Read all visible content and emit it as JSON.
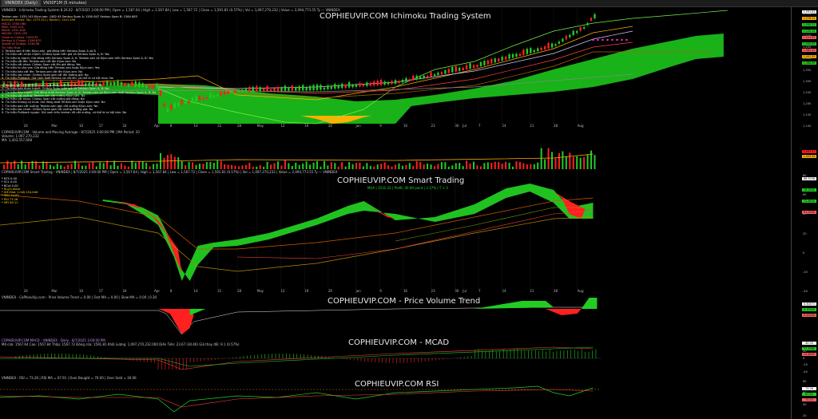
{
  "tabs": [
    {
      "label": "VNINDEX (Daily)",
      "active": true
    },
    {
      "label": "VN30F1M (5 minutes)",
      "active": false
    }
  ],
  "colors": {
    "up": "#22cc22",
    "down": "#ff2020",
    "kumo": "#19b219",
    "lime": "#76f04a",
    "gold": "#ffb000",
    "magenta": "#ff33cc",
    "orange": "#cc7a00"
  },
  "panel1": {
    "header": "VNINDEX - Ichimoku Trading System 8.26.02 - 8/7/2025 3:00:00 PM | Open = 1,567.64 | High = 1,567.84 | Low = 1,567.72 | Close = 1,591.81 (0.57%) | Vol = 1,097,270,232 | Value = 2,094,773.55 Ty — VNINDEX",
    "title": "COPHIEUVIP.COM Ichimoku Trading System",
    "legend": [
      {
        "text": "Tenkan-sen: 1535.145   Kijun-sen: 1482.45   Senkou Span A: 1500.847   Senkou Span B: 1364.685",
        "color": "#e8e8e8"
      },
      {
        "text": "Bollinger Bands: Top: 1579.312 | Bottom: 1441.498",
        "color": "#ffb000"
      },
      {
        "text": "MACD: 1500.064",
        "color": "#ff6060"
      },
      {
        "text": "MA5: 1545.214",
        "color": "#ff6060"
      },
      {
        "text": "MA20: 1531.618",
        "color": "#ff6060"
      },
      {
        "text": "MA200: 1305.139",
        "color": "#ff6060"
      },
      {
        "text": "Close vs Chikou: 1583.99",
        "color": "#ff6060"
      },
      {
        "text": "Senkou A Chikou: 1298.870",
        "color": "#ff6060"
      },
      {
        "text": "SpanB vs Chikou: 1236.98",
        "color": "#ff6060"
      },
      {
        "text": "Tin hiệu Mua:",
        "color": "#ff6060"
      },
      {
        "text": "1. Tenkan-sen ở trên Kijun-sen, giá đóng trên Senkou Span A và B",
        "color": "#e8e8e8"
      },
      {
        "text": "2. Tín hiệu cắt: nhận mạnh: Chikou Span trên giá và Senkou Span A, B: Yes",
        "color": "#e8e8e8"
      },
      {
        "text": "3. Tín hiệu bị mạnh: Giá đóng trên Senkou Span A, B. Tenkan-sen và Kijun-sen trên Senkou Span A, B: Yes",
        "color": "#e8e8e8"
      },
      {
        "text": "4. Tín hiệu cắt lên: Tenkan-sen cắt lên Kijun-sen: No",
        "color": "#e8e8e8"
      },
      {
        "text": "5. Tín hiệu cắt nhan: Chikou Span cắt lên giá đóng: Yes",
        "color": "#e8e8e8"
      },
      {
        "text": "6. Tín hiệu to cho yes: Giá đóng trên Tenkan-sen hoặc Kijun-sen: Yes",
        "color": "#e8e8e8"
      },
      {
        "text": "7. Tín hiệu bán cắt lên: Tenkan-sen cắt lên Kijun-sen: No",
        "color": "#e8e8e8"
      },
      {
        "text": "8. Tín hiệu sac nhan: Chikou Span gạn cắt lên đường giá: No",
        "color": "#e8e8e8"
      },
      {
        "text": "9. Tín hiệu Pullback: Giá nam dưới tenkan và cắt lên, có thể là cơ hội mua: No",
        "color": "#e8e8e8"
      },
      {
        "text": "Tín hiệu Bán:",
        "color": "#ff6060"
      },
      {
        "text": "1. Tenkan-sen ở dưới Kijun-sen, giá đóng dưới Senkou Span A và B: No",
        "color": "#e8e8e8"
      },
      {
        "text": "2. Tín hiệu bán nhan mạnh: Chikou Span dưới giá và Senkou Span A, B: No",
        "color": "#e8e8e8"
      },
      {
        "text": "3. Tín hiệu Bán mạnh: Giá đóng dưới Senkou Span A, B. Tenkan-sen và Kijun-sen dưới Senkou Span A, B: No",
        "color": "#e8e8e8"
      },
      {
        "text": "4. Tín hiệu cắt xuống: Tenkan-sen cắt xuống Kijun-sen: No",
        "color": "#e8e8e8"
      },
      {
        "text": "5. Tín hiệu cắt nhan: Chikou Span cắt xuống giá đóng: No",
        "color": "#e8e8e8"
      },
      {
        "text": "6. Tín hiệu Khang cự mua: Giá đóng dưới Tenkan-sen hoặc Kijun-sen: No",
        "color": "#e8e8e8"
      },
      {
        "text": "7. Tín hiệu gạn cắt xuống: Tenkan-sen gạn cắt xuống Kijun-sen: No",
        "color": "#e8e8e8"
      },
      {
        "text": "8. Tín hiệu sac nhan: Chikou Span gạn cắt xuống đường giá: No",
        "color": "#e8e8e8"
      },
      {
        "text": "9. Tín hiệu Pullback ngược: Giá nam trên tenkan rồi cắt xuống, có thể là cơ hội bán: No",
        "color": "#e8e8e8"
      }
    ],
    "price_tags": [
      {
        "text": "1,591.81",
        "bg": "#ffffff"
      },
      {
        "text": "1,578.31",
        "bg": "#ffb000"
      },
      {
        "text": "1,545.21",
        "bg": "#22cc22"
      },
      {
        "text": "1,535.15",
        "bg": "#22cc22"
      },
      {
        "text": "1,531.62",
        "bg": "#ff6060"
      },
      {
        "text": "1,500.85",
        "bg": "#22cc22"
      },
      {
        "text": "1,482.45",
        "bg": "#ff6060"
      },
      {
        "text": "1,441.50",
        "bg": "#ffb000"
      },
      {
        "text": "1,364.69",
        "bg": "#22cc22"
      }
    ],
    "axis_labels": [
      "1,600",
      "1,550",
      "1,500",
      "1,450",
      "1,400",
      "1,350",
      "1,300",
      "1,250",
      "1,200",
      "1,150",
      "1,100"
    ]
  },
  "xaxis": {
    "labels": [
      {
        "text": "24",
        "pos": 0.03
      },
      {
        "text": "Mar",
        "pos": 0.065
      },
      {
        "text": "10",
        "pos": 0.1
      },
      {
        "text": "17",
        "pos": 0.125
      },
      {
        "text": "24",
        "pos": 0.155
      },
      {
        "text": "Apr",
        "pos": 0.195
      },
      {
        "text": "8",
        "pos": 0.215
      },
      {
        "text": "14",
        "pos": 0.245
      },
      {
        "text": "21",
        "pos": 0.275
      },
      {
        "text": "28",
        "pos": 0.3
      },
      {
        "text": "May",
        "pos": 0.325
      },
      {
        "text": "12",
        "pos": 0.355
      },
      {
        "text": "19",
        "pos": 0.385
      },
      {
        "text": "26",
        "pos": 0.415
      },
      {
        "text": "Jun",
        "pos": 0.45
      },
      {
        "text": "9",
        "pos": 0.48
      },
      {
        "text": "16",
        "pos": 0.51
      },
      {
        "text": "23",
        "pos": 0.545
      },
      {
        "text": "30",
        "pos": 0.575
      },
      {
        "text": "Jul",
        "pos": 0.585
      },
      {
        "text": "7",
        "pos": 0.605
      },
      {
        "text": "14",
        "pos": 0.635
      },
      {
        "text": "21",
        "pos": 0.67
      },
      {
        "text": "28",
        "pos": 0.7
      },
      {
        "text": "Aug",
        "pos": 0.73
      }
    ]
  },
  "panel2": {
    "header": "COPHIEUVIP.COM - Volume and Moving Average - 8/7/2025 3:00:00 PM | MA Period: 20",
    "line2": "Volume: 1,097,270,232",
    "line3": "MA: 1,403,557,608",
    "tags": [
      {
        "text": "1,097.27",
        "bg": "#ff2020"
      },
      {
        "text": "1,403.56",
        "bg": "#ffb000"
      }
    ]
  },
  "panel3": {
    "header": "COPHIEUVIP.COM Smart Trading - VNINDEX | 8/7/2025 3:00:00 PM | Open = 1,567.64 | High = 1,567.84 | Low = 1,567.72 | Close = 1,591.81 (0.57%) | Vol = 1,097,270,232 | Value = 2,094,773.55 Ty — VNINDEX",
    "title": "COPHIEUVIP.COM Smart Trading",
    "subinfo": "MUA | 1531.22 | Profit: 40.69 point | 3.17% | T + 3",
    "legend": [
      {
        "text": "* BTS    0.00",
        "color": "#e8e8e8"
      },
      {
        "text": "* SCL    0.00",
        "color": "#e8e8e8"
      },
      {
        "text": "* BCut   0.00",
        "color": "#e8e8e8"
      },
      {
        "text": "* BuyCutlose",
        "color": "#ffd000"
      },
      {
        "text": "* SM1Fast  1.040,254,646",
        "color": "#ffd000"
      },
      {
        "text": "* SD1    44.63",
        "color": "#ffd000"
      },
      {
        "text": "* RSI   73.26",
        "color": "#ffd000"
      },
      {
        "text": "* MFI   80.11",
        "color": "#ffd000"
      }
    ],
    "tags": [
      {
        "text": "88.9256",
        "bg": "#ffffff"
      },
      {
        "text": "76.2830",
        "bg": "#22cc22"
      },
      {
        "text": "72.8835",
        "bg": "#22cc22"
      },
      {
        "text": "61.0049",
        "bg": "#ff6060"
      }
    ],
    "axis_labels": [
      "80",
      "60",
      "40",
      "20",
      "0",
      "-20",
      "-40"
    ]
  },
  "panel4": {
    "header": "VNINDEX - CoPhieuVip.com - Price Volume Trend = 0.00 | Fast MA = 0.00 | Slow MA = 0.00 | 0.30",
    "title": "COPHIEUVIP.COM - Price Volume Trend",
    "tags": [
      {
        "text": "0.30471",
        "bg": "#ffffff"
      },
      {
        "text": "0.10000",
        "bg": "#22cc22"
      },
      {
        "text": "0.00000",
        "bg": "#ff6060"
      }
    ]
  },
  "panel5": {
    "header": "COPHIEUVIP.COM MACD - VNINDEX - Daily - 8/7/2025 3:00:00 PM",
    "line2": "Mở cửa: 1567.64  Cao: 1567.84  Thấp: 1567.72  Đóng cửa: 1591.81  Khối Lượng: 1,097,270,232.000  Diễn Tiến: 23.67 (30.46)  Giá thay đổi: 9.1 (0.57%)",
    "title": "COPHIEUVIP.COM - MCAD",
    "tags": [
      {
        "text": "40.00",
        "bg": "#ffffff"
      },
      {
        "text": "37.3060",
        "bg": "#22cc22"
      },
      {
        "text": "20.6895",
        "bg": "#ff6060"
      }
    ],
    "axis_labels": [
      "40",
      "20",
      "0",
      "-20",
      "-40"
    ]
  },
  "panel6": {
    "header": "VNINDEX - RSI = 73.26 | RSI MA = 67.91 | Over Bought = 70.00 | Over Sold = 30.00",
    "title": "COPHIEUVIP.COM RSI",
    "tags": [
      {
        "text": "73.26",
        "bg": "#ffffff"
      },
      {
        "text": "67.91",
        "bg": "#22cc22"
      },
      {
        "text": "70.00",
        "bg": "#ff6060"
      }
    ],
    "axis_labels": [
      "80",
      "60",
      "40",
      "20"
    ]
  }
}
